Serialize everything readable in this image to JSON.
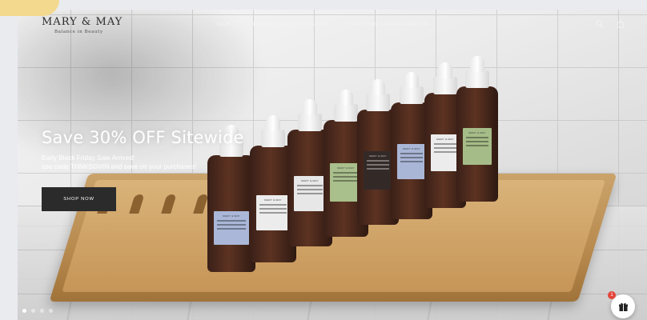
{
  "brand": {
    "name": "MARY & MAY",
    "tagline": "Balance in Beauty"
  },
  "nav": {
    "items": [
      {
        "label": "SHOP"
      },
      {
        "label": "DAY TIME SKINCARE ROUTINE"
      },
      {
        "label": "NIGHT TIME SKINCARE ROUTINE"
      }
    ]
  },
  "header_icons": [
    "search-icon",
    "bag-icon"
  ],
  "hero": {
    "headline": "Save 30% OFF Sitewide",
    "sub1": "Early Black Friday Sale Arrived!",
    "sub2": "use code THNKSGVIN and save on your purchases!",
    "cta_label": "SHOP NOW"
  },
  "bottle_brand_text": "MARY & MAY",
  "carousel": {
    "slides": 4,
    "active": 1
  },
  "gift": {
    "badge": "1"
  },
  "colors": {
    "accent_dark": "#2b2b2b",
    "badge": "#e2463b",
    "corner_accent": "#f3d98e"
  }
}
